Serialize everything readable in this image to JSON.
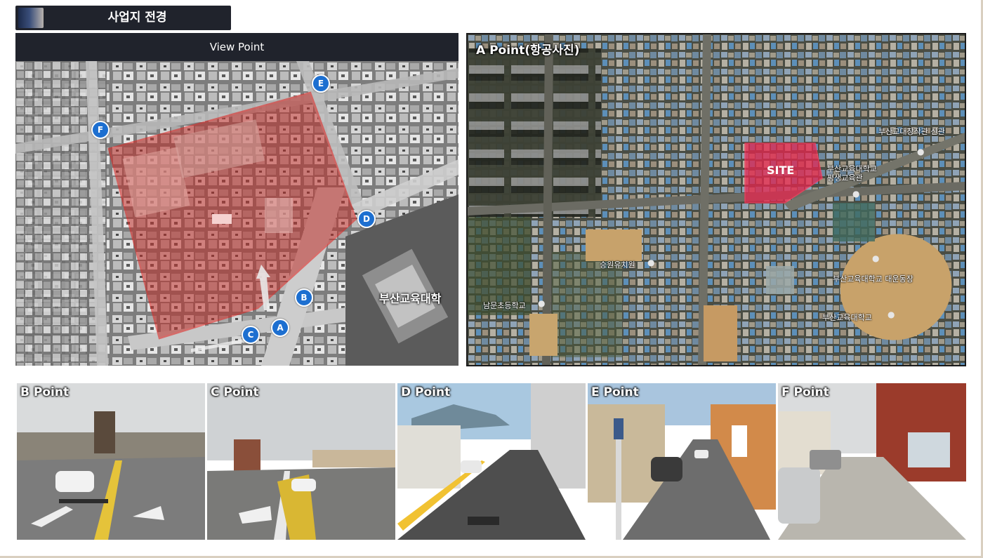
{
  "title": "사업지 전경",
  "left_panel": {
    "header": "View Point",
    "campus_label": "부산교육대학",
    "markers": [
      "A",
      "B",
      "C",
      "D",
      "E",
      "F"
    ]
  },
  "aerial": {
    "title": "A Point(항공사진)",
    "site_label": "SITE",
    "places": [
      "부산교대창작관 신관",
      "부산교육대학교 평생교육관",
      "부산교육대학교 대운동장",
      "부산교육대학교",
      "승원유치원",
      "남문초등학교"
    ]
  },
  "street_views": [
    {
      "label": "B Point"
    },
    {
      "label": "C Point"
    },
    {
      "label": "D Point"
    },
    {
      "label": "E Point"
    },
    {
      "label": "F Point"
    }
  ],
  "colors": {
    "banner": "#20232c",
    "site_overlay": "#c0302a",
    "marker": "#1d6fd0",
    "site_pink": "#e8264e"
  }
}
